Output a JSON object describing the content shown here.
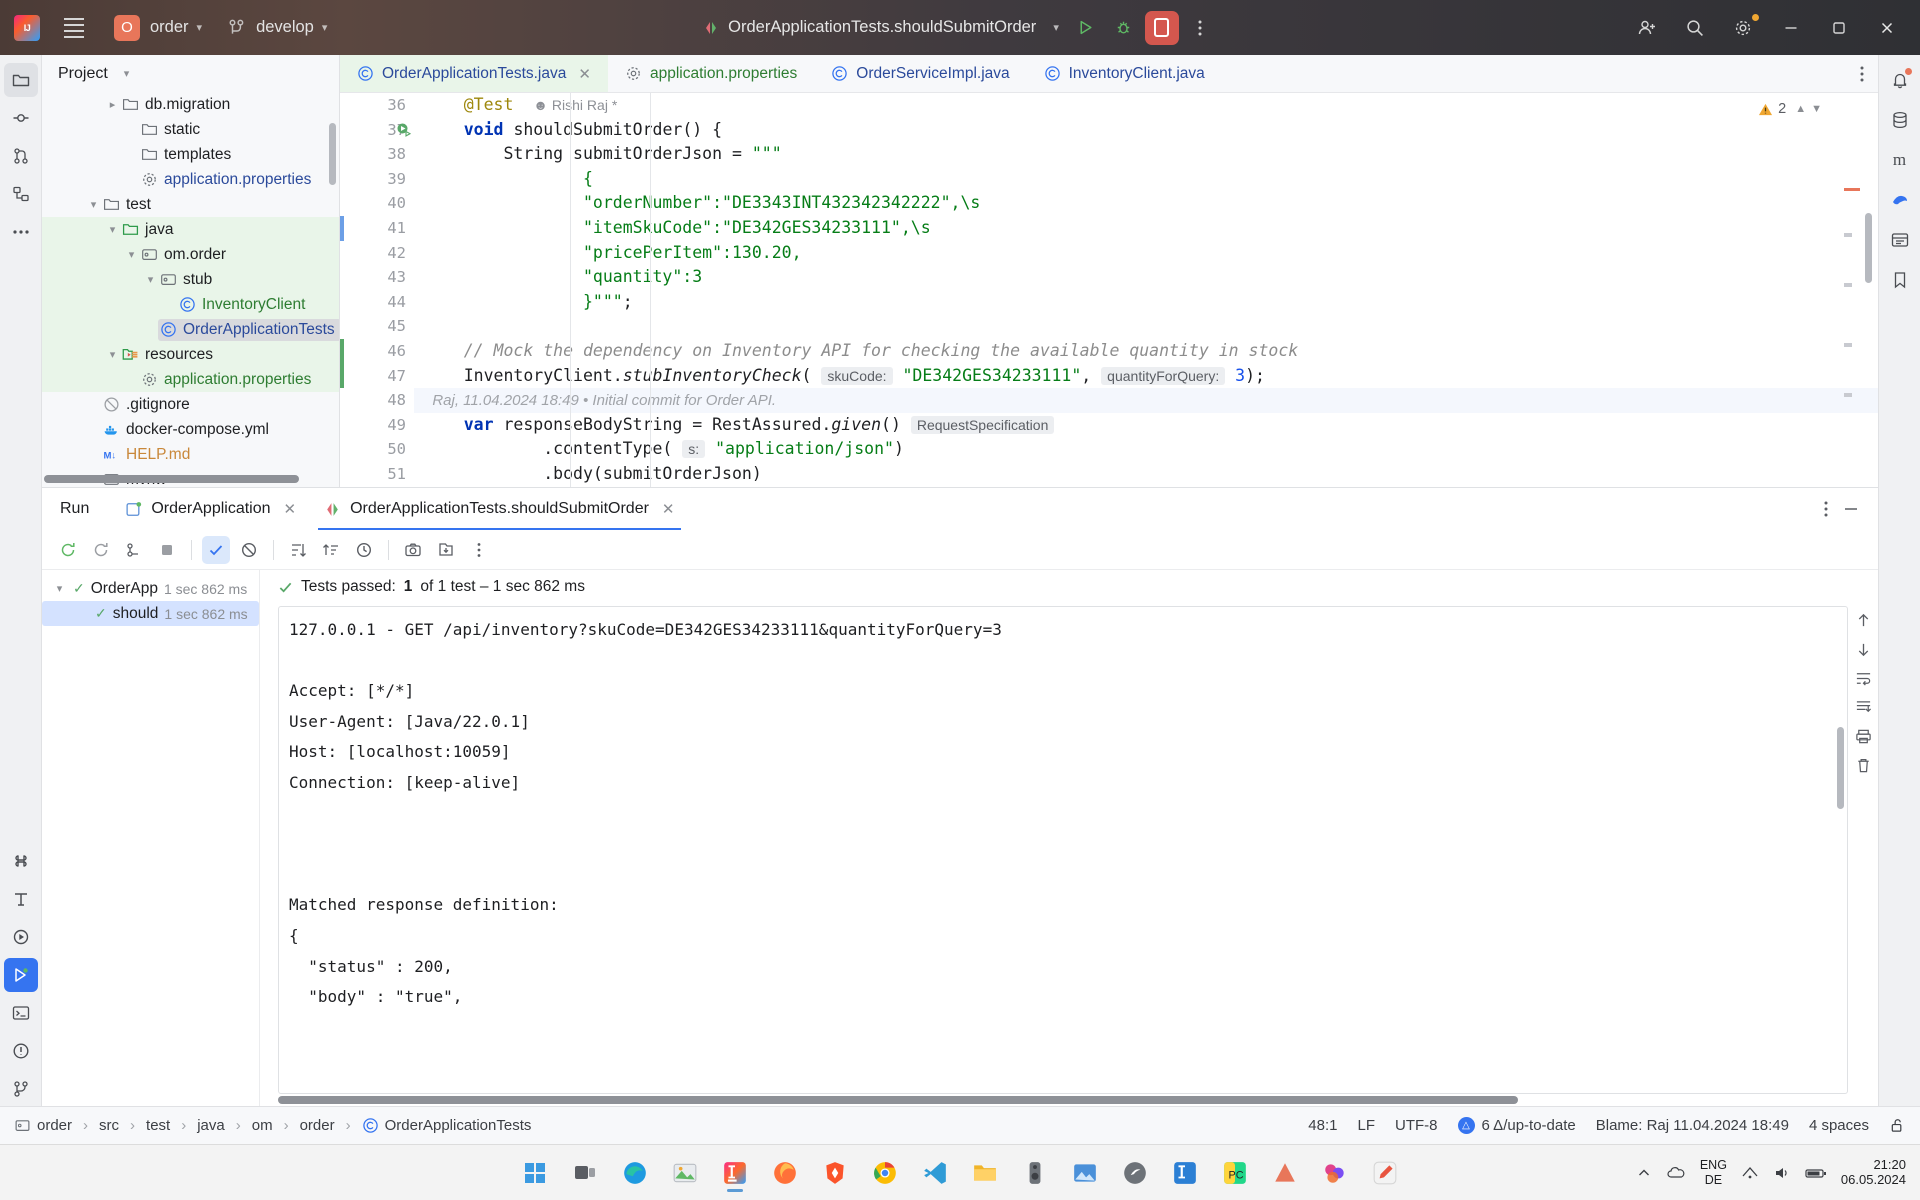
{
  "titlebar": {
    "project_initial": "O",
    "project_name": "order",
    "branch": "develop",
    "run_config": "OrderApplicationTests.shouldSubmitOrder"
  },
  "project_panel": {
    "title": "Project",
    "tree": [
      {
        "indent": 3,
        "arrow": "collapsed",
        "icon": "folder-icon",
        "label": "db.migration",
        "color": "dark",
        "zone": "none"
      },
      {
        "indent": 4,
        "arrow": "none",
        "icon": "folder-icon",
        "label": "static",
        "color": "dark",
        "zone": "none"
      },
      {
        "indent": 4,
        "arrow": "none",
        "icon": "folder-icon",
        "label": "templates",
        "color": "dark",
        "zone": "none"
      },
      {
        "indent": 4,
        "arrow": "none",
        "icon": "properties-icon",
        "label": "application.properties",
        "color": "blue",
        "zone": "none"
      },
      {
        "indent": 2,
        "arrow": "expanded",
        "icon": "folder-icon",
        "label": "test",
        "color": "dark",
        "zone": "none"
      },
      {
        "indent": 3,
        "arrow": "expanded",
        "icon": "source-root-icon",
        "label": "java",
        "color": "dark",
        "zone": "green"
      },
      {
        "indent": 4,
        "arrow": "expanded",
        "icon": "package-icon",
        "label": "om.order",
        "color": "dark",
        "zone": "green"
      },
      {
        "indent": 5,
        "arrow": "expanded",
        "icon": "package-icon",
        "label": "stub",
        "color": "dark",
        "zone": "green"
      },
      {
        "indent": 6,
        "arrow": "none",
        "icon": "class-icon",
        "label": "InventoryClient",
        "color": "green",
        "zone": "green"
      },
      {
        "indent": 5,
        "arrow": "none",
        "icon": "class-icon",
        "label": "OrderApplicationTests",
        "color": "blue",
        "zone": "green",
        "selected": true
      },
      {
        "indent": 3,
        "arrow": "expanded",
        "icon": "test-resource-icon",
        "label": "resources",
        "color": "dark",
        "zone": "green"
      },
      {
        "indent": 4,
        "arrow": "none",
        "icon": "properties-icon",
        "label": "application.properties",
        "color": "green",
        "zone": "green"
      },
      {
        "indent": 2,
        "arrow": "none",
        "icon": "gitignore-icon",
        "label": ".gitignore",
        "color": "dark",
        "zone": "none"
      },
      {
        "indent": 2,
        "arrow": "none",
        "icon": "docker-icon",
        "label": "docker-compose.yml",
        "color": "dark",
        "zone": "none"
      },
      {
        "indent": 2,
        "arrow": "none",
        "icon": "markdown-icon",
        "label": "HELP.md",
        "color": "orange",
        "zone": "none"
      },
      {
        "indent": 2,
        "arrow": "none",
        "icon": "shell-icon",
        "label": "mvnw",
        "color": "dark",
        "zone": "none"
      }
    ]
  },
  "editor": {
    "tabs": [
      {
        "label": "OrderApplicationTests.java",
        "icon": "class-icon",
        "active": true,
        "closable": true
      },
      {
        "label": "application.properties",
        "icon": "properties-icon",
        "active": false,
        "closable": false
      },
      {
        "label": "OrderServiceImpl.java",
        "icon": "class-icon",
        "active": false,
        "closable": false
      },
      {
        "label": "InventoryClient.java",
        "icon": "class-icon",
        "active": false,
        "closable": false
      }
    ],
    "warning_count": "2",
    "first_line_number": 36,
    "lines": [
      {
        "n": 36,
        "html": "    <span class='ann'>@Test</span>  <span class='author'>&#9787; Rishi Raj *</span>"
      },
      {
        "n": 37,
        "html": "    <span class='k'>void</span> <span class='id'>shouldSubmitOrder</span>() {",
        "runmark": true
      },
      {
        "n": 38,
        "html": "        <span class='id'>String</span> <span class='id'>submitOrderJson</span> = <span class='s'>\"\"\"</span>"
      },
      {
        "n": 39,
        "html": "                <span class='s'>{</span>"
      },
      {
        "n": 40,
        "html": "                <span class='s'>\"orderNumber\":\"DE3343INT432342342222\",\\s</span>"
      },
      {
        "n": 41,
        "html": "                <span class='s'>\"itemSkuCode\":\"DE342GES34233111\",\\s</span>",
        "marker": "blue"
      },
      {
        "n": 42,
        "html": "                <span class='s'>\"pricePerItem\":130.20,</span>"
      },
      {
        "n": 43,
        "html": "                <span class='s'>\"quantity\":3</span>"
      },
      {
        "n": 44,
        "html": "                <span class='s'>}\"\"\"</span>;"
      },
      {
        "n": 45,
        "html": ""
      },
      {
        "n": 46,
        "html": "    <span class='cm'>// Mock the dependency on Inventory API for checking the available quantity in stock</span>",
        "marker": "green"
      },
      {
        "n": 47,
        "html": "    <span class='id'>InventoryClient</span>.<span class='it'>stubInventoryCheck</span>( <span class='hintbox'>skuCode:</span> <span class='s'>\"DE342GES34233111\"</span>, <span class='hintbox'>quantityForQuery:</span> <span class='n'>3</span>);",
        "marker": "green"
      },
      {
        "n": 48,
        "html": "<span class='blame'>  Raj, 11.04.2024 18:49 &bull; Initial commit for Order API.</span>",
        "current": true
      },
      {
        "n": 49,
        "html": "    <span class='k'>var</span> <span class='id'>responseBodyString</span> = <span class='id'>RestAssured</span>.<span class='it'>given</span>() <span class='hintbox'>RequestSpecification</span>"
      },
      {
        "n": 50,
        "html": "            .<span class='id'>contentType</span>( <span class='hintbox'>s:</span> <span class='s'>\"application/json\"</span>)"
      },
      {
        "n": 51,
        "html": "            .<span class='id'>body</span>(<span class='id'>submitOrderJson</span>)"
      }
    ]
  },
  "run_window": {
    "label": "Run",
    "tabs": [
      {
        "label": "OrderApplication",
        "icon": "app-icon",
        "active": false,
        "closable": true
      },
      {
        "label": "OrderApplicationTests.shouldSubmitOrder",
        "icon": "test-icon",
        "active": true,
        "closable": true
      }
    ],
    "test_tree": [
      {
        "label": "OrderApp",
        "duration": "1 sec 862 ms",
        "expanded": true,
        "selected": false
      },
      {
        "label": "should",
        "duration": "1 sec 862 ms",
        "expanded": false,
        "selected": true
      }
    ],
    "summary": {
      "prefix": "Tests passed:",
      "passed": "1",
      "rest": "of 1 test – 1 sec 862 ms"
    },
    "console_lines": [
      "127.0.0.1 - GET /api/inventory?skuCode=DE342GES34233111&quantityForQuery=3",
      "",
      "Accept: [*/*]",
      "User-Agent: [Java/22.0.1]",
      "Host: [localhost:10059]",
      "Connection: [keep-alive]",
      "",
      "",
      "",
      "Matched response definition:",
      "{",
      "  \"status\" : 200,",
      "  \"body\" : \"true\","
    ]
  },
  "status_bar": {
    "breadcrumbs": [
      "order",
      "src",
      "test",
      "java",
      "om",
      "order",
      "OrderApplicationTests"
    ],
    "caret": "48:1",
    "line_separator": "LF",
    "encoding": "UTF-8",
    "vcs": "6 Δ/up-to-date",
    "blame": "Blame: Raj 11.04.2024 18:49",
    "indent": "4 spaces"
  },
  "taskbar": {
    "language": "ENG",
    "region": "DE",
    "time": "21:20",
    "date": "06.05.2024"
  }
}
